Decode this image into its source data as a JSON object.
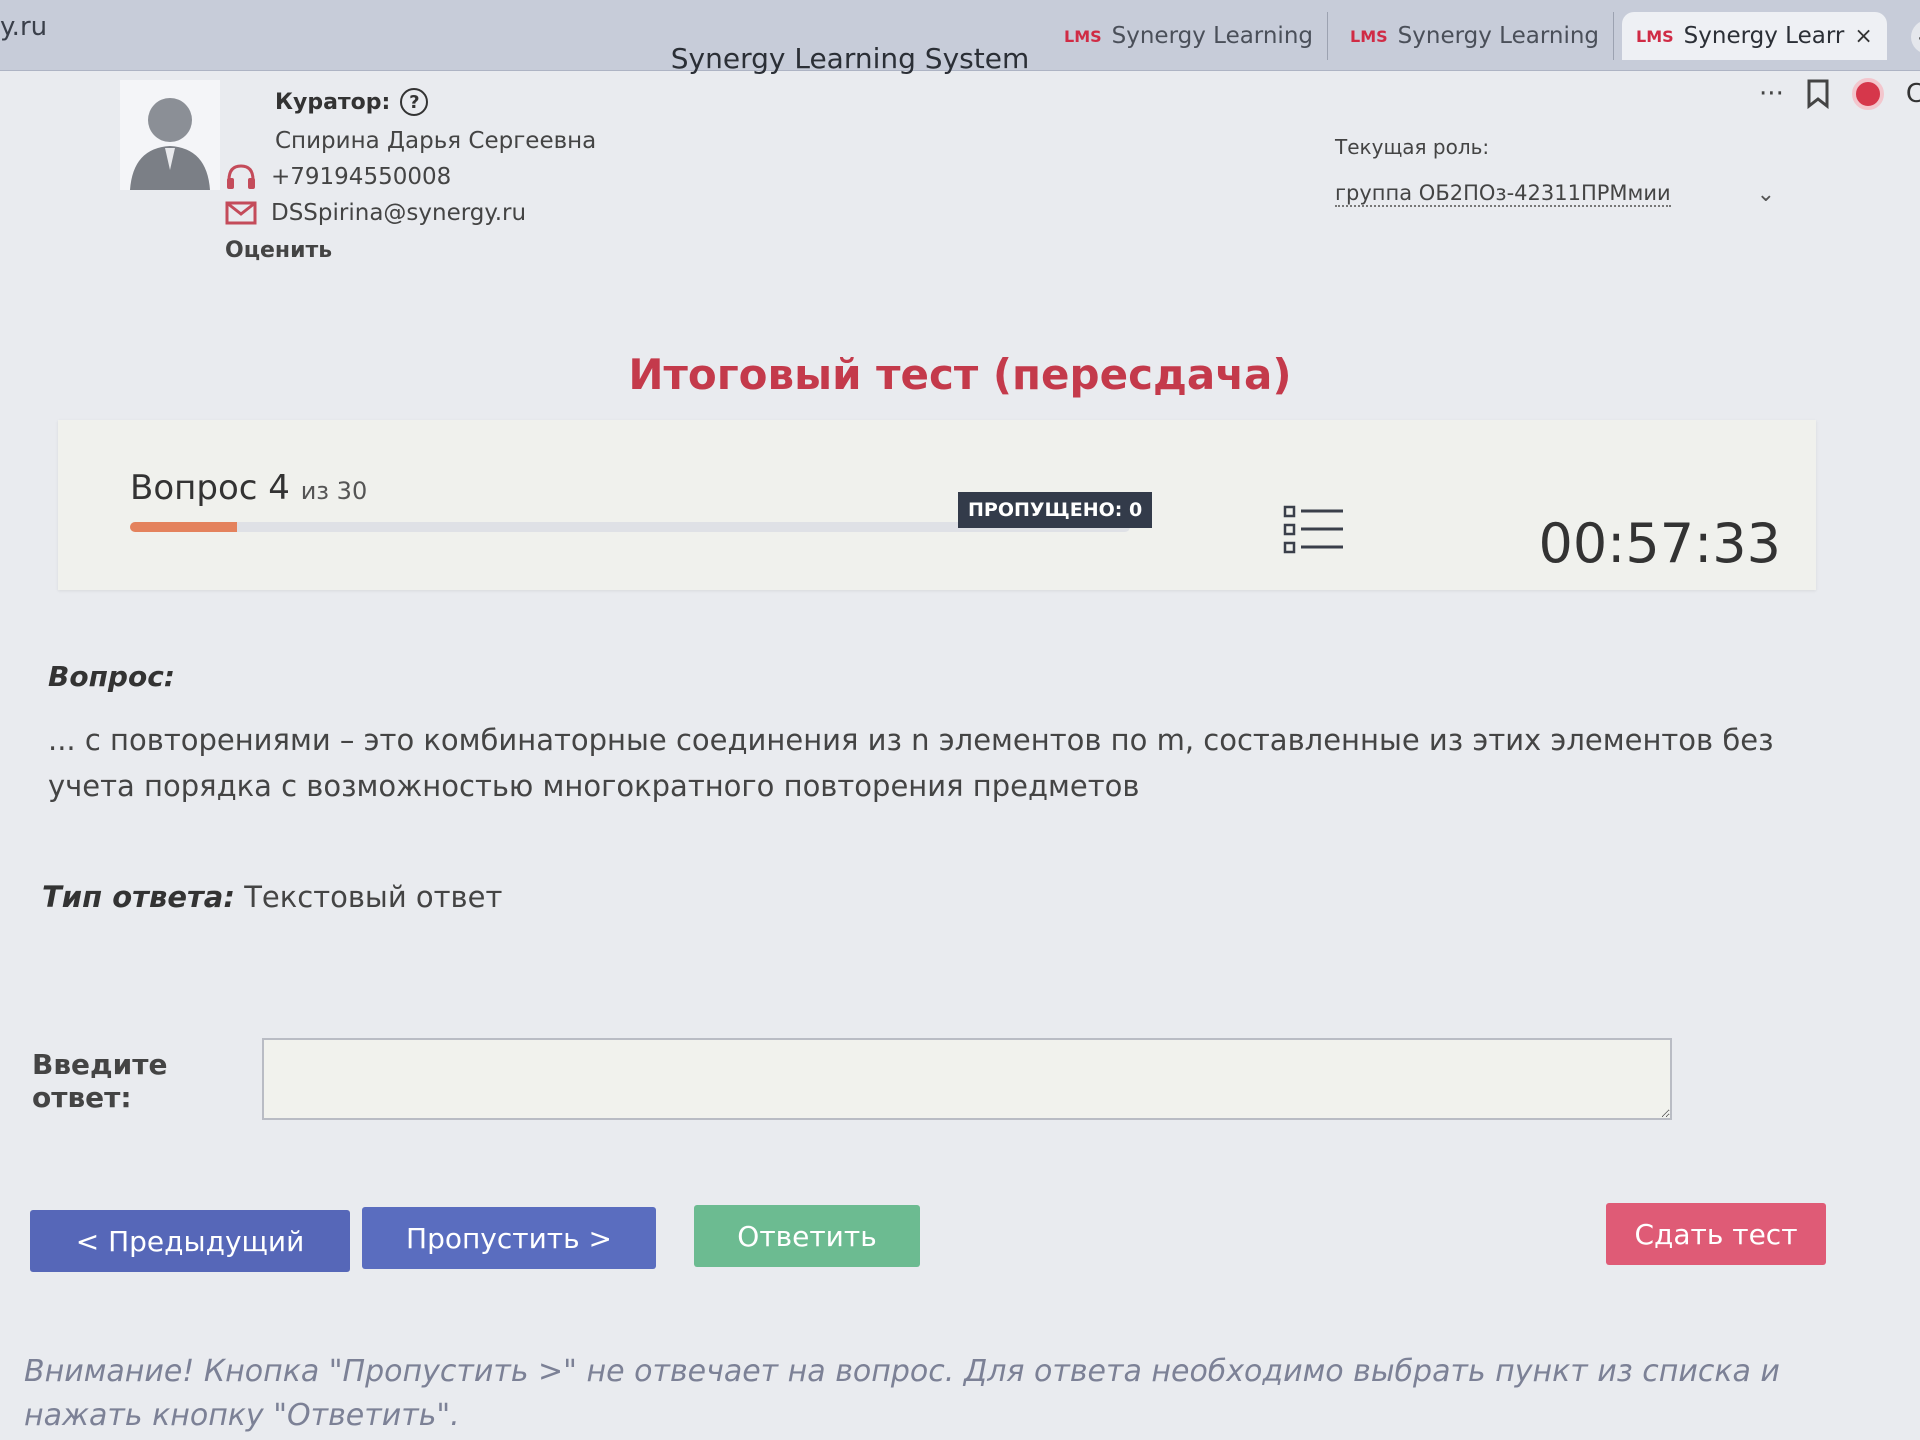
{
  "browser": {
    "url_fragment": "y.ru",
    "window_title": "Synergy Learning System",
    "tabs": [
      {
        "label": "Synergy Learning"
      },
      {
        "label": "Synergy Learning"
      },
      {
        "label": "Synergy Learr"
      }
    ],
    "tab_logo": "LMS",
    "tab_close": "×",
    "new_tab": "+",
    "more_icon": "···",
    "profile_fragment": "C"
  },
  "curator": {
    "title": "Куратор:",
    "help_glyph": "?",
    "name": "Спирина Дарья Сергеевна",
    "phone": "+79194550008",
    "email": "DSSpirina@synergy.ru",
    "rate_label": "Оценить"
  },
  "role": {
    "label": "Текущая роль:",
    "selected": "группа ОБ2ПОз-42311ПРМмии",
    "chevron": "⌄"
  },
  "test": {
    "title": "Итоговый тест (пересдача)"
  },
  "progress": {
    "question_label": "Вопрос 4",
    "question_of": "из 30",
    "fraction": 0.1067,
    "skipped_label": "ПРОПУЩЕНО: 0",
    "timer": "00:57:33"
  },
  "question": {
    "heading": "Вопрос:",
    "text": "... с повторениями – это комбинаторные соединения из n элементов по m, составленные из этих элементов без учета порядка с возможностью многократного повторения предметов"
  },
  "answer_type": {
    "label": "Тип ответа:",
    "value": "Текстовый ответ"
  },
  "answer": {
    "label": "Введите ответ:",
    "value": ""
  },
  "buttons": {
    "prev": "< Предыдущий",
    "skip": "Пропустить >",
    "answer": "Ответить",
    "submit": "Сдать тест"
  },
  "warning": "Внимание! Кнопка \"Пропустить >\" не отвечает на вопрос. Для ответа необходимо выбрать пункт из списка и нажать кнопку \"Ответить\".",
  "colors": {
    "title_red": "#c43a4b",
    "progress_fill": "#e4825d",
    "btn_blue": "#5667b8",
    "btn_green": "#6cbb91",
    "btn_red": "#df5b76",
    "badge_dark": "#333b4a"
  }
}
